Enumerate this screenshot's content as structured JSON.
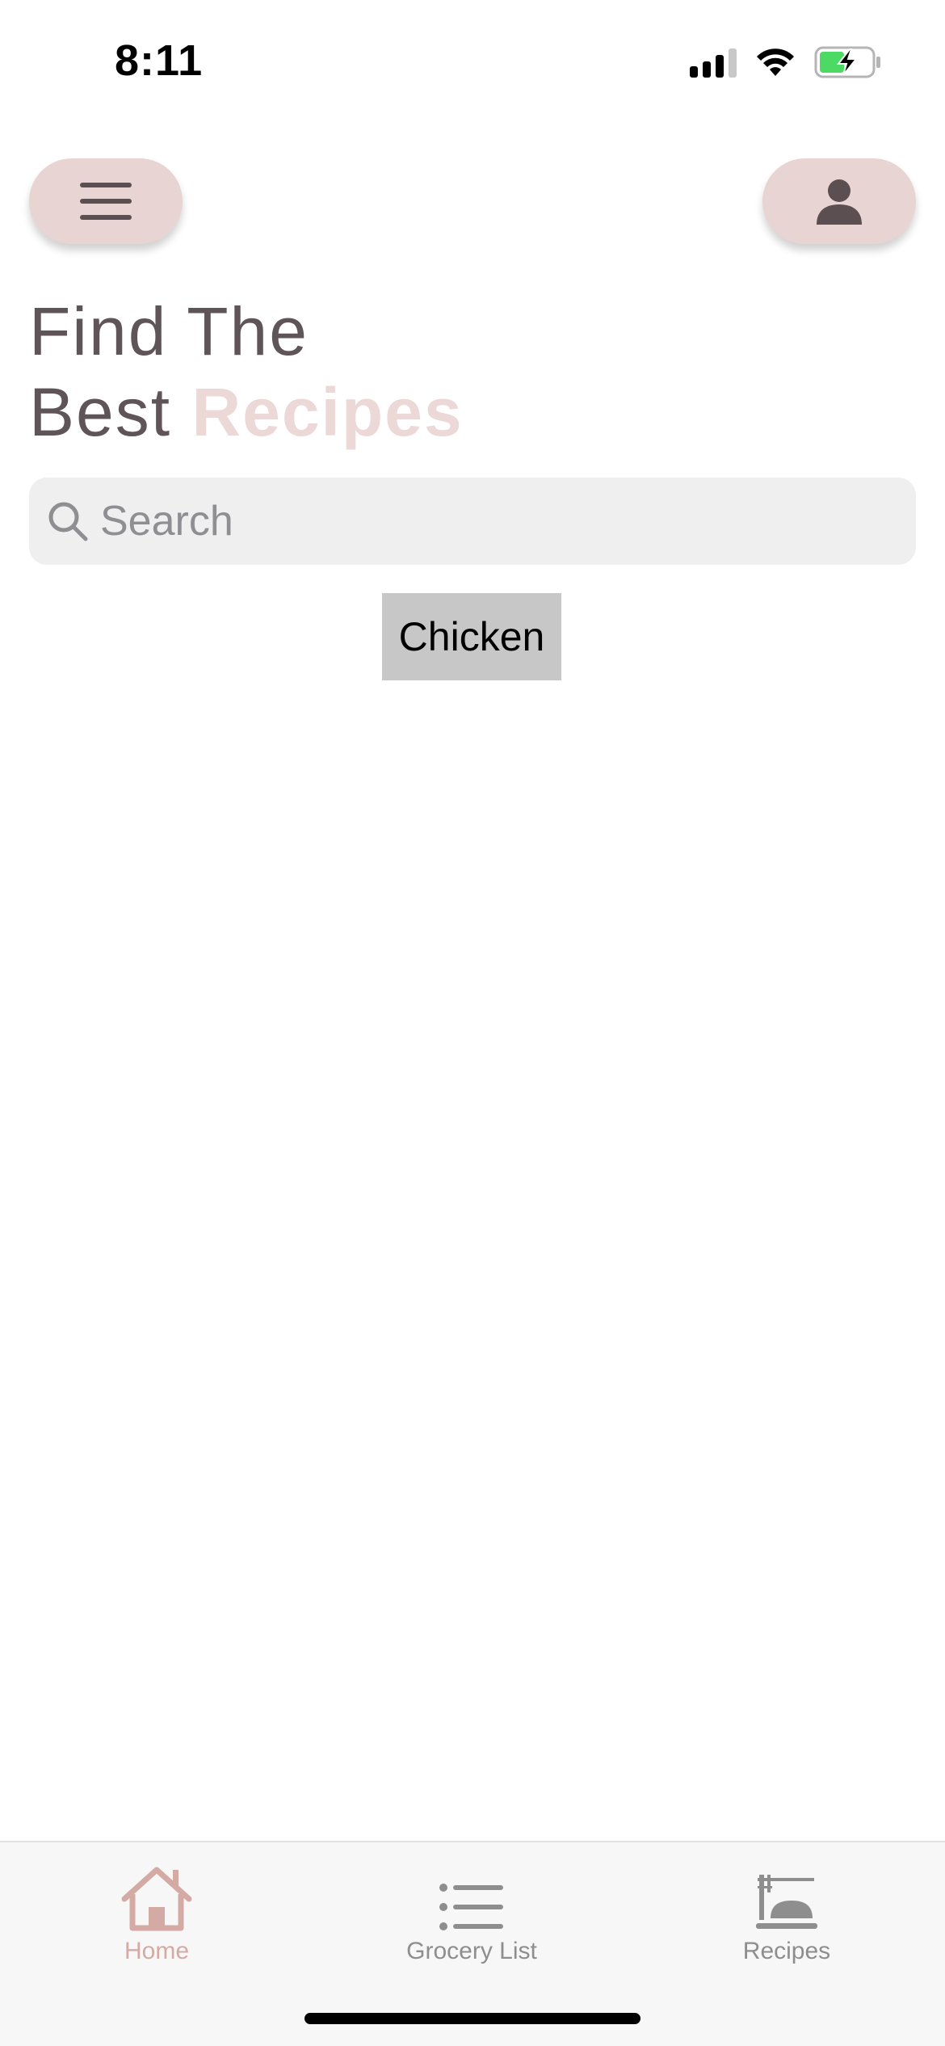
{
  "status_bar": {
    "time": "8:11",
    "icons": [
      "cellular-signal-icon",
      "wifi-icon",
      "battery-charging-icon"
    ],
    "battery_color": "#4cd964"
  },
  "header": {
    "menu_icon": "hamburger-menu-icon",
    "profile_icon": "person-icon",
    "button_bg": "#e8d5d3"
  },
  "headline": {
    "line1": "Find The",
    "line2_prefix": "Best",
    "line2_accent": "Recipes",
    "text_color": "#5f5457",
    "accent_color": "#ecd8d6"
  },
  "search": {
    "placeholder": "Search",
    "value": "",
    "icon": "search-icon"
  },
  "chips": [
    {
      "label": "Chicken"
    }
  ],
  "tab_bar": {
    "active_color": "#d4aaa4",
    "inactive_color": "#8e8e8e",
    "tabs": [
      {
        "label": "Home",
        "icon": "home-icon",
        "active": true
      },
      {
        "label": "Grocery List",
        "icon": "list-icon",
        "active": false
      },
      {
        "label": "Recipes",
        "icon": "food-tray-icon",
        "active": false
      }
    ]
  }
}
